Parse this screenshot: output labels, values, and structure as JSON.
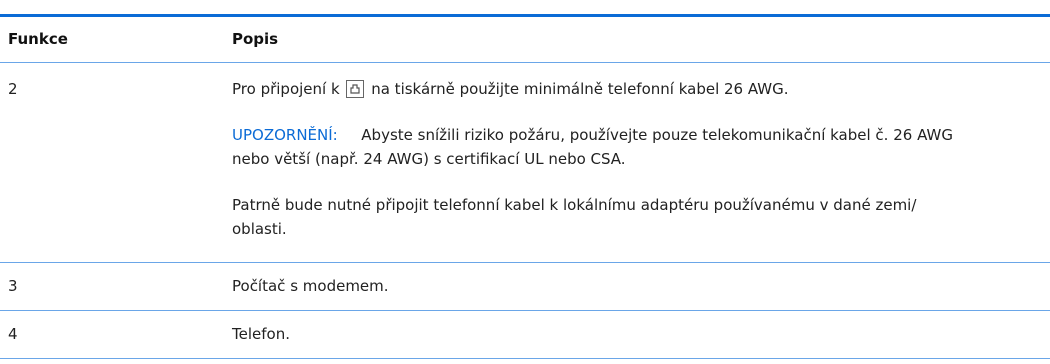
{
  "header": {
    "col_feature": "Funkce",
    "col_description": "Popis"
  },
  "rows": [
    {
      "feature": "2",
      "p1_before": "Pro připojení k",
      "p1_icon": "telephone-port-icon",
      "p1_after": "na tiskárně použijte minimálně telefonní kabel 26 AWG.",
      "warning_label": "UPOZORNĚNÍ:",
      "warning_line1": "Abyste snížili riziko požáru, používejte pouze telekomunikační kabel č. 26 AWG",
      "warning_line2": "nebo větší (např. 24 AWG) s certifikací UL nebo CSA.",
      "p3_line1": "Patrně bude nutné připojit telefonní kabel k lokálnímu adaptéru používanému v dané zemi/",
      "p3_line2": "oblasti."
    },
    {
      "feature": "3",
      "description": "Počítač s modemem."
    },
    {
      "feature": "4",
      "description": "Telefon."
    }
  ],
  "colors": {
    "accent": "#0b6bd6",
    "rule": "#6aa6e8"
  }
}
